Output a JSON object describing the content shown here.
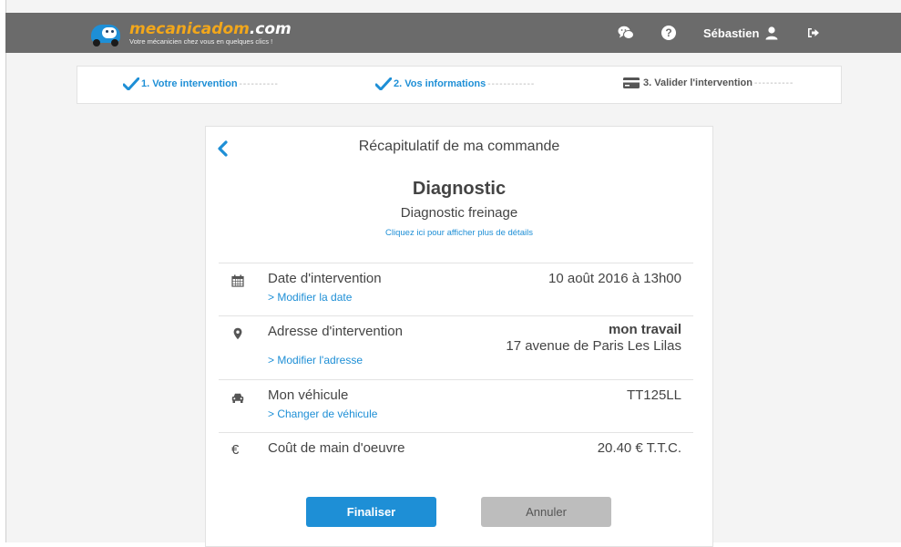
{
  "header": {
    "brand_name": "mecanicadom",
    "brand_tld": ".com",
    "tagline": "Votre mécanicien chez vous en quelques clics !",
    "user_name": "Sébastien",
    "icons": [
      "chat-icon",
      "help-icon",
      "user-icon",
      "logout-icon"
    ],
    "colors": {
      "bar": "#6b6b6b",
      "brand_orange": "#f2a71b",
      "accent_blue": "#1e8fd6"
    }
  },
  "steps": [
    {
      "label": "1. Votre intervention",
      "status": "done",
      "icon": "check-icon"
    },
    {
      "label": "2. Vos informations",
      "status": "done",
      "icon": "check-icon"
    },
    {
      "label": "3. Valider l'intervention",
      "status": "current",
      "icon": "credit-card-icon"
    }
  ],
  "summary": {
    "title": "Récapitulatif de ma commande",
    "service": "Diagnostic",
    "service_detail": "Diagnostic freinage",
    "details_link": "Cliquez ici pour afficher plus de détails",
    "rows": [
      {
        "icon": "calendar-icon",
        "label": "Date d'intervention",
        "link": "> Modifier la date",
        "value": "10 août 2016 à 13h00"
      },
      {
        "icon": "map-marker-icon",
        "label": "Adresse d'intervention",
        "link": "> Modifier l'adresse",
        "value_title": "mon travail",
        "value": "17 avenue de Paris Les Lilas"
      },
      {
        "icon": "car-icon",
        "label": "Mon véhicule",
        "link": "> Changer de véhicule",
        "value": "TT125LL"
      },
      {
        "icon": "euro-icon",
        "icon_glyph": "€",
        "label": "Coût de main d'oeuvre",
        "value": "20.40 € T.T.C."
      }
    ]
  },
  "actions": {
    "finalize": "Finaliser",
    "cancel": "Annuler"
  }
}
